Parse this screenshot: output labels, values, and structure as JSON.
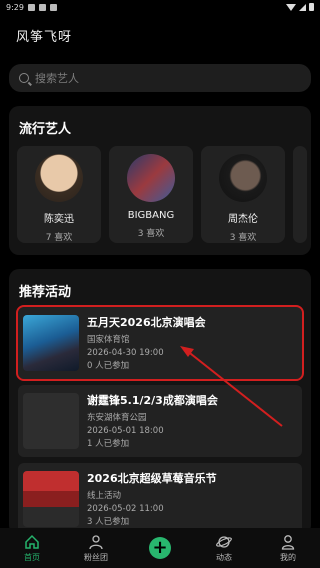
{
  "status": {
    "time": "9:29"
  },
  "header": {
    "title": "风筝飞呀"
  },
  "search": {
    "placeholder": "搜索艺人"
  },
  "trending": {
    "title": "流行艺人",
    "artists": [
      {
        "name": "陈奕迅",
        "likes": "7 喜欢"
      },
      {
        "name": "BIGBANG",
        "likes": "3 喜欢"
      },
      {
        "name": "周杰伦",
        "likes": "3 喜欢"
      }
    ]
  },
  "events": {
    "title": "推荐活动",
    "items": [
      {
        "title": "五月天2026北京演唱会",
        "venue": "国家体育馆",
        "datetime": "2026-04-30 19:00",
        "joined": "0 人已参加"
      },
      {
        "title": "谢霆锋5.1/2/3成都演唱会",
        "venue": "东安湖体育公园",
        "datetime": "2026-05-01 18:00",
        "joined": "1 人已参加"
      },
      {
        "title": "2026北京超级草莓音乐节",
        "venue": "线上活动",
        "datetime": "2026-05-02 11:00",
        "joined": "3 人已参加"
      }
    ]
  },
  "tabs": [
    {
      "label": "首页",
      "active": true
    },
    {
      "label": "粉丝团",
      "active": false
    },
    {
      "label": "",
      "active": false
    },
    {
      "label": "动态",
      "active": false
    },
    {
      "label": "我的",
      "active": false
    }
  ],
  "colors": {
    "accent": "#25b36c",
    "highlight": "#d21f1f"
  }
}
